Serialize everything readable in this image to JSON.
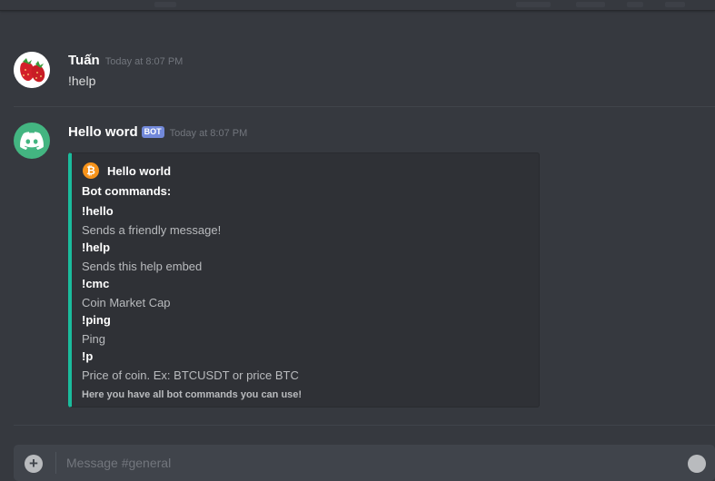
{
  "colors": {
    "background": "#36393f",
    "embed_accent": "#1abc9c",
    "bot_tag": "#7289da",
    "discord_avatar": "#43b581"
  },
  "messages": [
    {
      "author": "Tuấn",
      "timestamp": "Today at 8:07 PM",
      "avatar_icon": "strawberry-icon",
      "content": "!help"
    },
    {
      "author": "Hello word",
      "bot_tag": "BOT",
      "timestamp": "Today at 8:07 PM",
      "avatar_icon": "discord-logo-icon",
      "embed": {
        "author_icon": "bitcoin-icon",
        "author_name": "Hello world",
        "title": "Bot commands:",
        "fields": [
          {
            "name": "!hello",
            "value": "Sends a friendly message!"
          },
          {
            "name": "!help",
            "value": "Sends this help embed"
          },
          {
            "name": "!cmc",
            "value": "Coin Market Cap"
          },
          {
            "name": "!ping",
            "value": "Ping"
          },
          {
            "name": "!p",
            "value": "Price of coin. Ex: BTCUSDT or price BTC"
          }
        ],
        "footer": "Here you have all bot commands you can use!"
      }
    }
  ],
  "composer": {
    "placeholder": "Message #general",
    "left_icon": "add-plus-icon",
    "right_icon": "emoji-icon"
  }
}
